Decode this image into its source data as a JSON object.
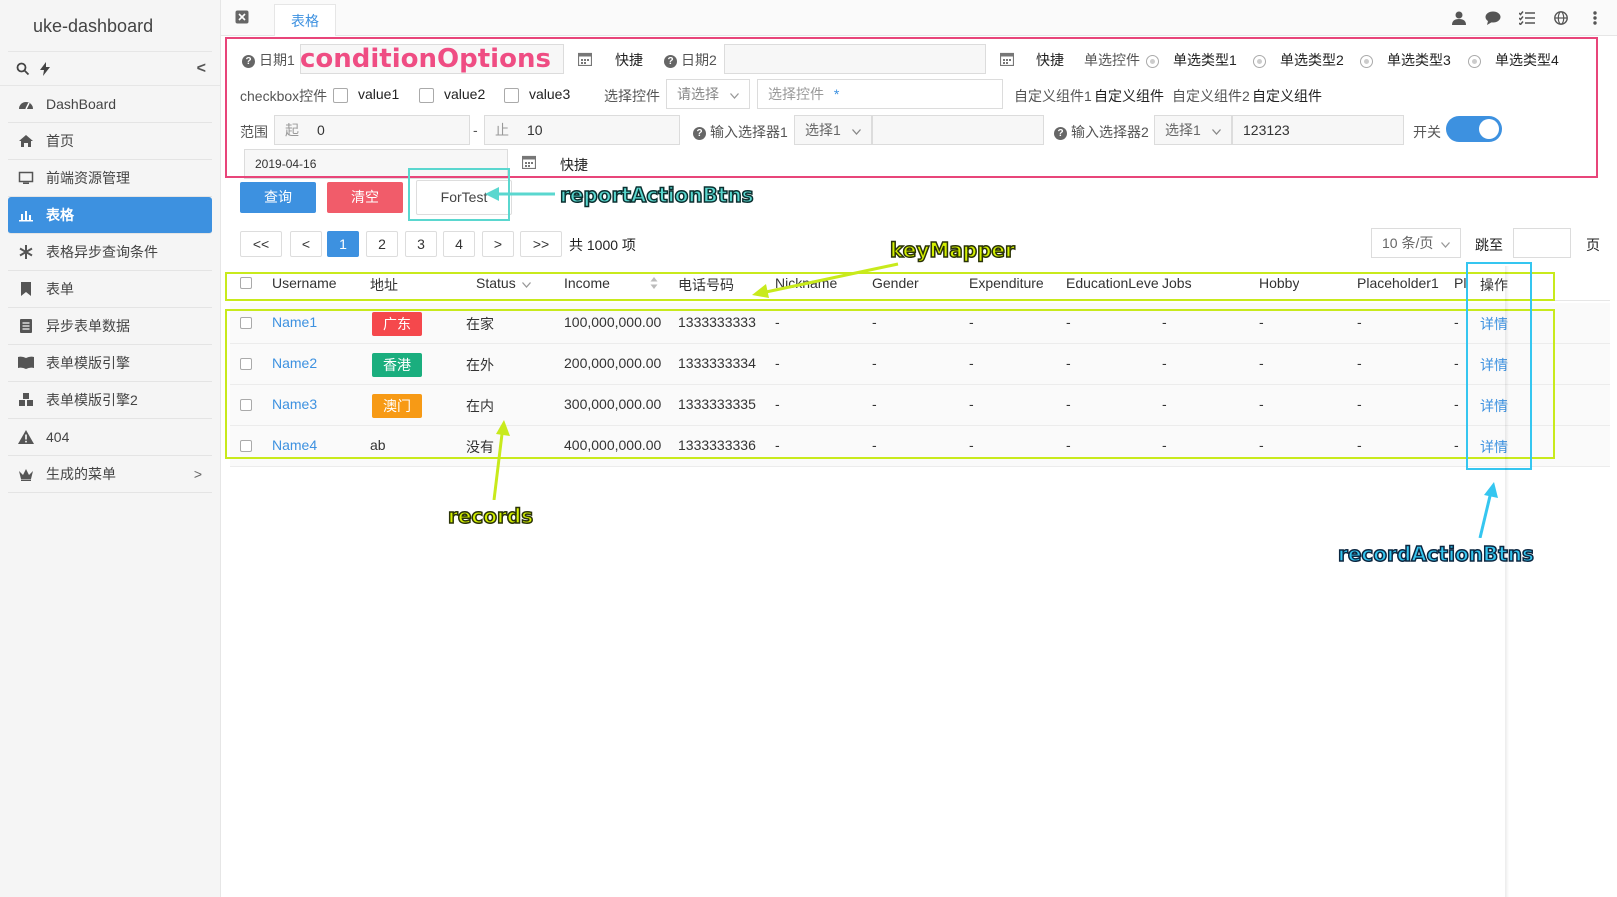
{
  "sidebar": {
    "app_title": "uke-dashboard",
    "collapse_label": "<",
    "items": [
      {
        "label": "DashBoard"
      },
      {
        "label": "首页"
      },
      {
        "label": "前端资源管理"
      },
      {
        "label": "表格"
      },
      {
        "label": "表格异步查询条件"
      },
      {
        "label": "表单"
      },
      {
        "label": "异步表单数据"
      },
      {
        "label": "表单模版引擎"
      },
      {
        "label": "表单模版引擎2"
      },
      {
        "label": "404"
      },
      {
        "label": "生成的菜单",
        "arrow": ">"
      }
    ]
  },
  "topbar": {
    "tab_label": "表格"
  },
  "conditions": {
    "date1_label": "日期1",
    "date1_quick": "快捷",
    "date2_label": "日期2",
    "date2_quick": "快捷",
    "radio_label": "单选控件",
    "radio_options": [
      "单选类型1",
      "单选类型2",
      "单选类型3",
      "单选类型4"
    ],
    "checkbox_label": "checkbox控件",
    "checkbox_options": [
      "value1",
      "value2",
      "value3"
    ],
    "select_label": "选择控件",
    "select_placeholder": "请选择",
    "select2_placeholder": "选择控件",
    "select2_required": "*",
    "custom1_label": "自定义组件1",
    "custom1_value": "自定义组件",
    "custom2_label": "自定义组件2",
    "custom2_value": "自定义组件",
    "range_label": "范围",
    "range_from_prefix": "起",
    "range_from": "0",
    "range_sep": "-",
    "range_to_prefix": "止",
    "range_to": "10",
    "input_select1_label": "输入选择器1",
    "input_select1_option": "选择1",
    "input_select2_label": "输入选择器2",
    "input_select2_option": "选择1",
    "input_select2_value": "123123",
    "switch_label": "开关",
    "switch_on": true,
    "date3_value": "2019-04-16",
    "date3_quick": "快捷"
  },
  "actions": {
    "query": "查询",
    "clear": "清空",
    "fortest": "ForTest"
  },
  "pagination": {
    "first": "<<",
    "prev": "<",
    "pages": [
      "1",
      "2",
      "3",
      "4"
    ],
    "current": "1",
    "next": ">",
    "last": ">>",
    "total": "共 1000 项",
    "page_size": "10 条/页",
    "jump_label": "跳至",
    "jump_suffix": "页"
  },
  "table": {
    "columns": [
      "Username",
      "地址",
      "Status",
      "Income",
      "电话号码",
      "Nickname",
      "Gender",
      "Expenditure",
      "EducationLeve",
      "Jobs",
      "Hobby",
      "Placeholder1",
      "Pl",
      "操作"
    ],
    "rows": [
      {
        "username": "Name1",
        "address": "广东",
        "address_color": "#f5484c",
        "status": "在家",
        "income": "100,000,000.00",
        "phone": "1333333333",
        "rest": [
          "-",
          "-",
          "-",
          "-",
          "-",
          "-",
          "-",
          "-"
        ],
        "action": "详情"
      },
      {
        "username": "Name2",
        "address": "香港",
        "address_color": "#1aae7e",
        "status": "在外",
        "income": "200,000,000.00",
        "phone": "1333333334",
        "rest": [
          "-",
          "-",
          "-",
          "-",
          "-",
          "-",
          "-",
          "-"
        ],
        "action": "详情"
      },
      {
        "username": "Name3",
        "address": "澳门",
        "address_color": "#f79a15",
        "status": "在内",
        "income": "300,000,000.00",
        "phone": "1333333335",
        "rest": [
          "-",
          "-",
          "-",
          "-",
          "-",
          "-",
          "-",
          "-"
        ],
        "action": "详情"
      },
      {
        "username": "Name4",
        "address": "ab",
        "address_color": "",
        "status": "没有",
        "income": "400,000,000.00",
        "phone": "1333333336",
        "rest": [
          "-",
          "-",
          "-",
          "-",
          "-",
          "-",
          "-",
          "-"
        ],
        "action": "详情"
      }
    ]
  },
  "annotations": {
    "conditionOptions": "conditionOptions",
    "reportActionBtns": "reportActionBtns",
    "keyMapper": "keyMapper",
    "records": "records",
    "recordActionBtns": "recordActionBtns"
  },
  "colors": {
    "accent": "#3d91e0",
    "danger": "#f15c6a",
    "ann_pink": "#e8457a",
    "ann_cyan": "#5ad7cf",
    "ann_yellow": "#c8ea1c",
    "ann_blue": "#35c6f0"
  }
}
